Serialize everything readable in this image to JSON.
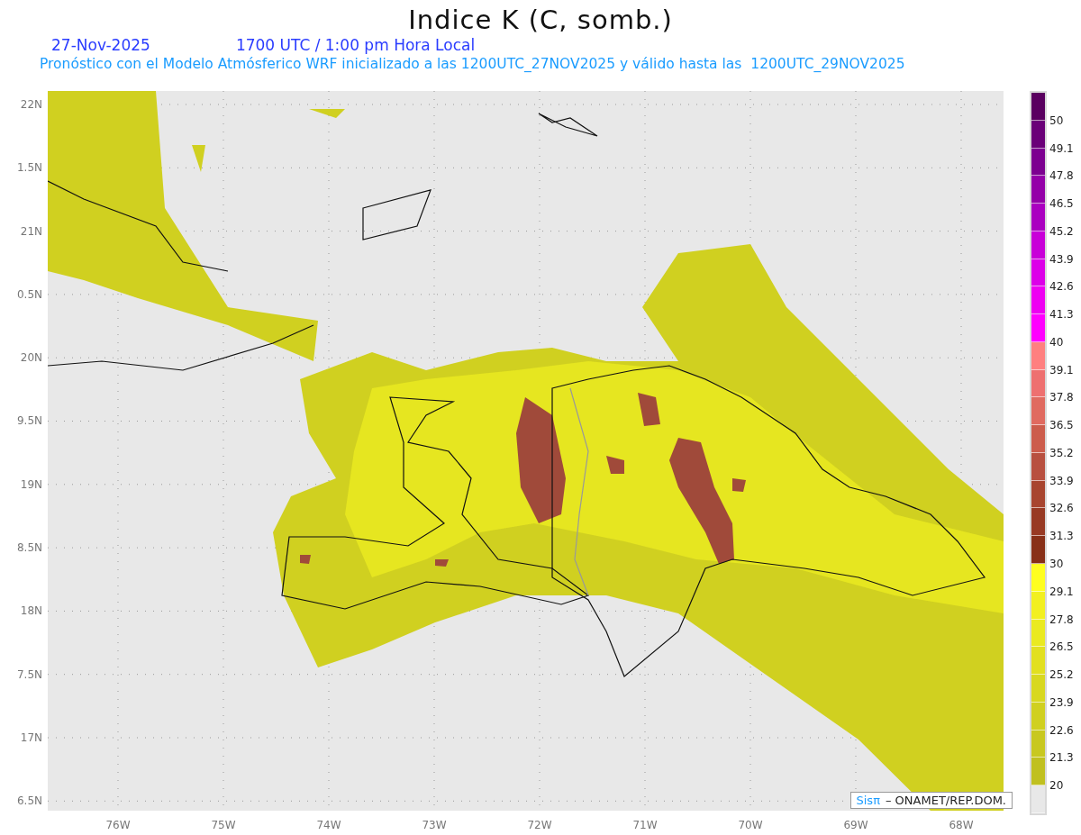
{
  "title": "Indice K (C, somb.)",
  "date": "27-Nov-2025",
  "time": "1700 UTC / 1:00 pm Hora Local",
  "subtitle": "Pronóstico con el Modelo Atmósferico WRF inicializado a las 1200UTC_27NOV2025 y válido hasta las  1200UTC_29NOV2025",
  "y_axis": [
    "22N",
    "1.5N",
    "21N",
    "0.5N",
    "20N",
    "9.5N",
    "19N",
    "8.5N",
    "18N",
    "7.5N",
    "17N",
    "6.5N"
  ],
  "x_axis": [
    "76W",
    "75W",
    "74W",
    "73W",
    "72W",
    "71W",
    "70W",
    "69W",
    "68W"
  ],
  "credit": {
    "mark": "Sisπ",
    "text": "– ONAMET/REP.DOM."
  },
  "legend": [
    {
      "label": "50",
      "color": "#5a0060"
    },
    {
      "label": "49.1",
      "color": "#6a0078"
    },
    {
      "label": "47.8",
      "color": "#7c0090"
    },
    {
      "label": "46.5",
      "color": "#9400a8"
    },
    {
      "label": "45.2",
      "color": "#aa00c0"
    },
    {
      "label": "43.9",
      "color": "#c800d8"
    },
    {
      "label": "42.6",
      "color": "#dc00e8"
    },
    {
      "label": "41.3",
      "color": "#ee00f2"
    },
    {
      "label": "40",
      "color": "#ff00ff"
    },
    {
      "label": "39.1",
      "color": "#ff8080"
    },
    {
      "label": "37.8",
      "color": "#ee7070"
    },
    {
      "label": "36.5",
      "color": "#e06a60"
    },
    {
      "label": "35.2",
      "color": "#cc5c4c"
    },
    {
      "label": "33.9",
      "color": "#b85040"
    },
    {
      "label": "32.6",
      "color": "#a8452f"
    },
    {
      "label": "31.3",
      "color": "#983a24"
    },
    {
      "label": "30",
      "color": "#883018"
    },
    {
      "label": "29.1",
      "color": "#ffff20"
    },
    {
      "label": "27.8",
      "color": "#f2f020"
    },
    {
      "label": "26.5",
      "color": "#eaea20"
    },
    {
      "label": "25.2",
      "color": "#e2e020"
    },
    {
      "label": "23.9",
      "color": "#d8d820"
    },
    {
      "label": "22.6",
      "color": "#d0d020"
    },
    {
      "label": "21.3",
      "color": "#c8c820"
    },
    {
      "label": "20",
      "color": "#c0c020"
    },
    {
      "color": "#e8e8e8"
    }
  ]
}
